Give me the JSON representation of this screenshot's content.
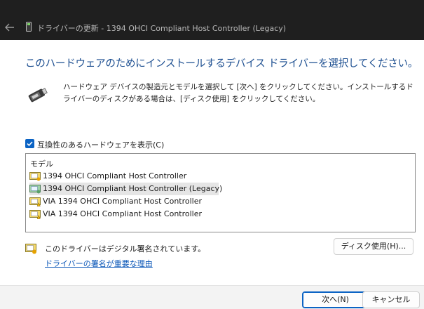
{
  "window": {
    "title": "ドライバーの更新 - 1394 OHCI Compliant Host Controller (Legacy)"
  },
  "page": {
    "heading": "このハードウェアのためにインストールするデバイス ドライバーを選択してください。",
    "description": "ハードウェア デバイスの製造元とモデルを選択して [次へ] をクリックしてください。インストールするドライバーのディスクがある場合は、[ディスク使用] をクリックしてください。"
  },
  "compat_checkbox": {
    "label": "互換性のあるハードウェアを表示(C)",
    "checked": true
  },
  "model_list": {
    "header": "モデル",
    "items": [
      {
        "label": "1394 OHCI Compliant Host Controller",
        "selected": false,
        "icon": "driver-certificate-icon"
      },
      {
        "label": "1394 OHCI Compliant Host Controller (Legacy)",
        "selected": true,
        "icon": "driver-certificate-icon"
      },
      {
        "label": "VIA 1394 OHCI Compliant Host Controller",
        "selected": false,
        "icon": "driver-warning-icon"
      },
      {
        "label": "VIA 1394 OHCI Compliant Host Controller",
        "selected": false,
        "icon": "driver-warning-icon"
      }
    ]
  },
  "signature": {
    "text": "このドライバーはデジタル署名されています。",
    "link": "ドライバーの署名が重要な理由",
    "icon": "signed-driver-icon"
  },
  "buttons": {
    "disk": "ディスク使用(H)...",
    "next": "次へ(N)",
    "cancel": "キャンセル"
  },
  "colors": {
    "heading": "#1d4f91",
    "accent": "#0b63c4",
    "link": "#0b57b8",
    "titlebar": "#1f1f1f"
  }
}
